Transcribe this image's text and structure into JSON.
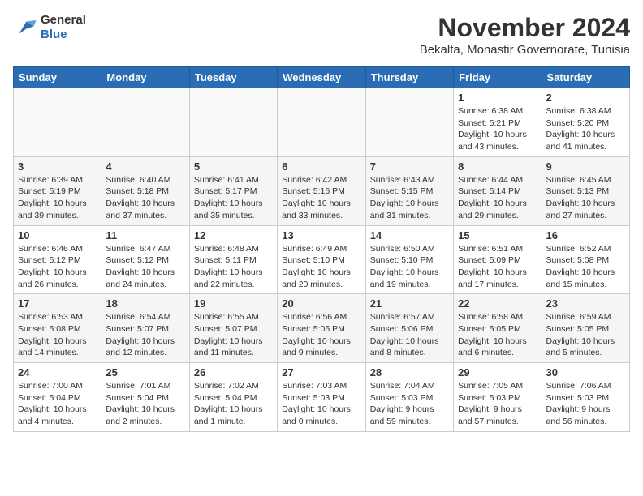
{
  "header": {
    "logo": {
      "line1": "General",
      "line2": "Blue"
    },
    "title": "November 2024",
    "subtitle": "Bekalta, Monastir Governorate, Tunisia"
  },
  "weekdays": [
    "Sunday",
    "Monday",
    "Tuesday",
    "Wednesday",
    "Thursday",
    "Friday",
    "Saturday"
  ],
  "weeks": [
    [
      {
        "day": "",
        "info": ""
      },
      {
        "day": "",
        "info": ""
      },
      {
        "day": "",
        "info": ""
      },
      {
        "day": "",
        "info": ""
      },
      {
        "day": "",
        "info": ""
      },
      {
        "day": "1",
        "info": "Sunrise: 6:38 AM\nSunset: 5:21 PM\nDaylight: 10 hours and 43 minutes."
      },
      {
        "day": "2",
        "info": "Sunrise: 6:38 AM\nSunset: 5:20 PM\nDaylight: 10 hours and 41 minutes."
      }
    ],
    [
      {
        "day": "3",
        "info": "Sunrise: 6:39 AM\nSunset: 5:19 PM\nDaylight: 10 hours and 39 minutes."
      },
      {
        "day": "4",
        "info": "Sunrise: 6:40 AM\nSunset: 5:18 PM\nDaylight: 10 hours and 37 minutes."
      },
      {
        "day": "5",
        "info": "Sunrise: 6:41 AM\nSunset: 5:17 PM\nDaylight: 10 hours and 35 minutes."
      },
      {
        "day": "6",
        "info": "Sunrise: 6:42 AM\nSunset: 5:16 PM\nDaylight: 10 hours and 33 minutes."
      },
      {
        "day": "7",
        "info": "Sunrise: 6:43 AM\nSunset: 5:15 PM\nDaylight: 10 hours and 31 minutes."
      },
      {
        "day": "8",
        "info": "Sunrise: 6:44 AM\nSunset: 5:14 PM\nDaylight: 10 hours and 29 minutes."
      },
      {
        "day": "9",
        "info": "Sunrise: 6:45 AM\nSunset: 5:13 PM\nDaylight: 10 hours and 27 minutes."
      }
    ],
    [
      {
        "day": "10",
        "info": "Sunrise: 6:46 AM\nSunset: 5:12 PM\nDaylight: 10 hours and 26 minutes."
      },
      {
        "day": "11",
        "info": "Sunrise: 6:47 AM\nSunset: 5:12 PM\nDaylight: 10 hours and 24 minutes."
      },
      {
        "day": "12",
        "info": "Sunrise: 6:48 AM\nSunset: 5:11 PM\nDaylight: 10 hours and 22 minutes."
      },
      {
        "day": "13",
        "info": "Sunrise: 6:49 AM\nSunset: 5:10 PM\nDaylight: 10 hours and 20 minutes."
      },
      {
        "day": "14",
        "info": "Sunrise: 6:50 AM\nSunset: 5:10 PM\nDaylight: 10 hours and 19 minutes."
      },
      {
        "day": "15",
        "info": "Sunrise: 6:51 AM\nSunset: 5:09 PM\nDaylight: 10 hours and 17 minutes."
      },
      {
        "day": "16",
        "info": "Sunrise: 6:52 AM\nSunset: 5:08 PM\nDaylight: 10 hours and 15 minutes."
      }
    ],
    [
      {
        "day": "17",
        "info": "Sunrise: 6:53 AM\nSunset: 5:08 PM\nDaylight: 10 hours and 14 minutes."
      },
      {
        "day": "18",
        "info": "Sunrise: 6:54 AM\nSunset: 5:07 PM\nDaylight: 10 hours and 12 minutes."
      },
      {
        "day": "19",
        "info": "Sunrise: 6:55 AM\nSunset: 5:07 PM\nDaylight: 10 hours and 11 minutes."
      },
      {
        "day": "20",
        "info": "Sunrise: 6:56 AM\nSunset: 5:06 PM\nDaylight: 10 hours and 9 minutes."
      },
      {
        "day": "21",
        "info": "Sunrise: 6:57 AM\nSunset: 5:06 PM\nDaylight: 10 hours and 8 minutes."
      },
      {
        "day": "22",
        "info": "Sunrise: 6:58 AM\nSunset: 5:05 PM\nDaylight: 10 hours and 6 minutes."
      },
      {
        "day": "23",
        "info": "Sunrise: 6:59 AM\nSunset: 5:05 PM\nDaylight: 10 hours and 5 minutes."
      }
    ],
    [
      {
        "day": "24",
        "info": "Sunrise: 7:00 AM\nSunset: 5:04 PM\nDaylight: 10 hours and 4 minutes."
      },
      {
        "day": "25",
        "info": "Sunrise: 7:01 AM\nSunset: 5:04 PM\nDaylight: 10 hours and 2 minutes."
      },
      {
        "day": "26",
        "info": "Sunrise: 7:02 AM\nSunset: 5:04 PM\nDaylight: 10 hours and 1 minute."
      },
      {
        "day": "27",
        "info": "Sunrise: 7:03 AM\nSunset: 5:03 PM\nDaylight: 10 hours and 0 minutes."
      },
      {
        "day": "28",
        "info": "Sunrise: 7:04 AM\nSunset: 5:03 PM\nDaylight: 9 hours and 59 minutes."
      },
      {
        "day": "29",
        "info": "Sunrise: 7:05 AM\nSunset: 5:03 PM\nDaylight: 9 hours and 57 minutes."
      },
      {
        "day": "30",
        "info": "Sunrise: 7:06 AM\nSunset: 5:03 PM\nDaylight: 9 hours and 56 minutes."
      }
    ]
  ]
}
